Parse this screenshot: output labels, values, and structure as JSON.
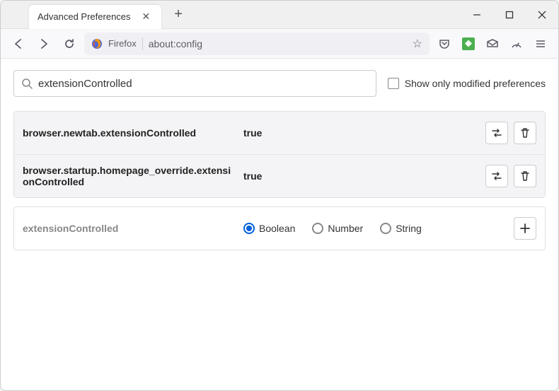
{
  "window": {
    "tab_title": "Advanced Preferences"
  },
  "toolbar": {
    "identity": "Firefox",
    "url": "about:config"
  },
  "search": {
    "value": "extensionControlled",
    "show_modified_label": "Show only modified preferences"
  },
  "prefs": [
    {
      "name": "browser.newtab.extensionControlled",
      "value": "true"
    },
    {
      "name": "browser.startup.homepage_override.extensionControlled",
      "value": "true"
    }
  ],
  "new_pref": {
    "name": "extensionControlled",
    "types": [
      "Boolean",
      "Number",
      "String"
    ],
    "selected": "Boolean"
  }
}
